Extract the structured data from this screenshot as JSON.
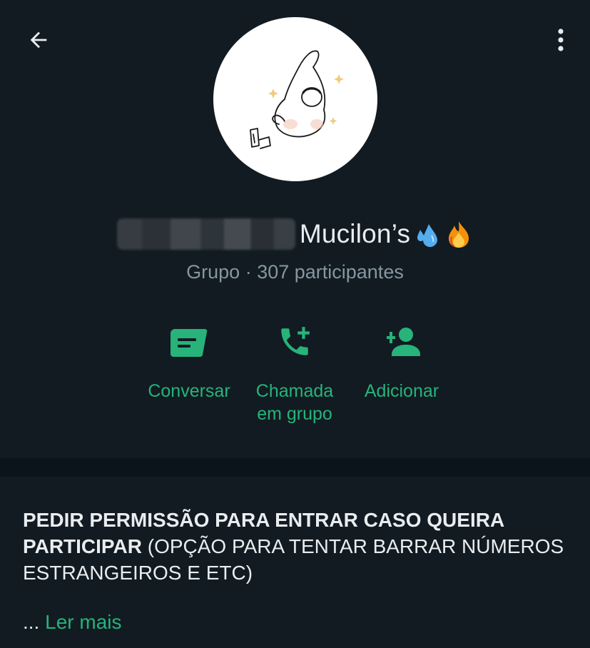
{
  "header": {
    "group_name": "Mucilon’s",
    "subtitle": "Grupo · 307 participantes",
    "name_emojis": [
      "droplets-emoji",
      "fire-emoji"
    ]
  },
  "actions": [
    {
      "icon": "message-icon",
      "label_line1": "Conversar",
      "label_line2": ""
    },
    {
      "icon": "call-add-icon",
      "label_line1": "Chamada",
      "label_line2": "em grupo"
    },
    {
      "icon": "add-person-icon",
      "label_line1": "Adicionar",
      "label_line2": ""
    }
  ],
  "description": {
    "bold_text": "PEDIR PERMISSÃO PARA ENTRAR CASO QUEIRA PARTICIPAR",
    "normal_text": " (OPÇÃO PARA TENTAR BARRAR NÚMEROS ESTRANGEIROS E ETC)",
    "ellipsis": "... ",
    "read_more": "Ler mais"
  },
  "colors": {
    "background": "#121b22",
    "accent": "#27b37a",
    "secondary_text": "#8696a0",
    "divider": "#0b141a"
  }
}
